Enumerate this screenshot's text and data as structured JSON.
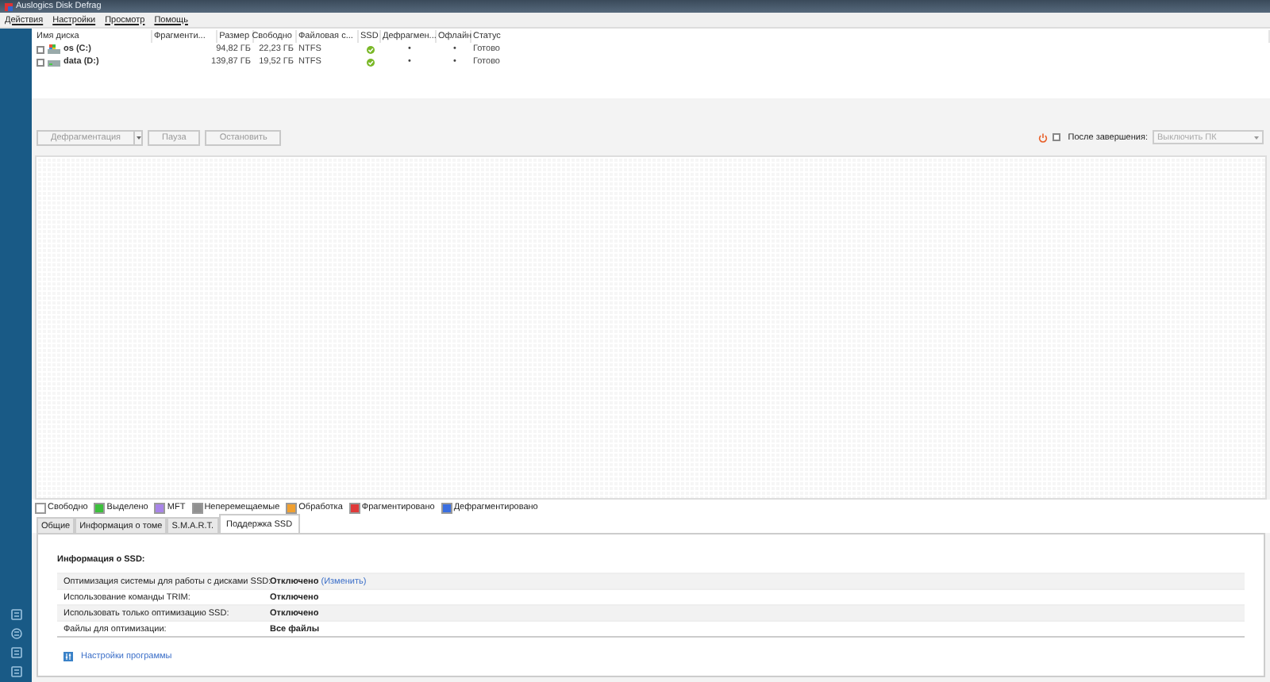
{
  "window": {
    "title": "Auslogics Disk Defrag"
  },
  "menu": [
    "Действия",
    "Настройки",
    "Просмотр",
    "Помощь"
  ],
  "disks": {
    "columns": [
      "Имя диска",
      "Фрагменти...",
      "Размер",
      "Свободно",
      "Файловая с...",
      "SSD",
      "Дефрагмен...",
      "Офлайн",
      "Статус"
    ],
    "rows": [
      {
        "checked": false,
        "kind": "system",
        "name": "os (C:)",
        "size": "94,82 ГБ",
        "free": "22,23 ГБ",
        "fs": "NTFS",
        "ssd": true,
        "defrag": "•",
        "offline": "•",
        "status": "Готово"
      },
      {
        "checked": false,
        "kind": "data",
        "name": "data (D:)",
        "size": "139,87 ГБ",
        "free": "19,52 ГБ",
        "fs": "NTFS",
        "ssd": true,
        "defrag": "•",
        "offline": "•",
        "status": "Готово"
      }
    ]
  },
  "toolbar": {
    "buttons": [
      {
        "label": "Дефрагментация",
        "kind": "split",
        "disabled": true
      },
      {
        "label": "Пауза",
        "kind": "plain",
        "disabled": true
      },
      {
        "label": "Остановить",
        "kind": "plain",
        "disabled": true
      }
    ],
    "after_finish": {
      "checked": false,
      "label": "После завершения:",
      "dropdown": {
        "value": "Выключить ПК",
        "disabled": true
      }
    }
  },
  "legend": [
    {
      "label": "Свободно",
      "color": "#ffffff"
    },
    {
      "label": "Выделено",
      "color": "#3cc03c"
    },
    {
      "label": "MFT",
      "color": "#a884e8"
    },
    {
      "label": "Неперемещаемые",
      "color": "#909090"
    },
    {
      "label": "Обработка",
      "color": "#f0a030"
    },
    {
      "label": "Фрагментировано",
      "color": "#e03a3a"
    },
    {
      "label": "Дефрагментировано",
      "color": "#3a6ee0"
    }
  ],
  "tabs": [
    {
      "label": "Общие",
      "selected": false
    },
    {
      "label": "Информация о томе",
      "selected": false
    },
    {
      "label": "S.M.A.R.T.",
      "selected": false
    },
    {
      "label": "Поддержка SSD",
      "selected": true
    }
  ],
  "ssd_panel": {
    "heading": "Информация о SSD:",
    "rows": [
      {
        "label": "Оптимизация системы для работы с дисками SSD:",
        "value": "Отключено",
        "link": "(Изменить)"
      },
      {
        "label": "Использование команды TRIM:",
        "value": "Отключено"
      },
      {
        "label": "Использовать только оптимизацию SSD:",
        "value": "Отключено"
      },
      {
        "label": "Файлы для оптимизации:",
        "value": "Все файлы"
      }
    ],
    "settings_link": "Настройки программы"
  }
}
